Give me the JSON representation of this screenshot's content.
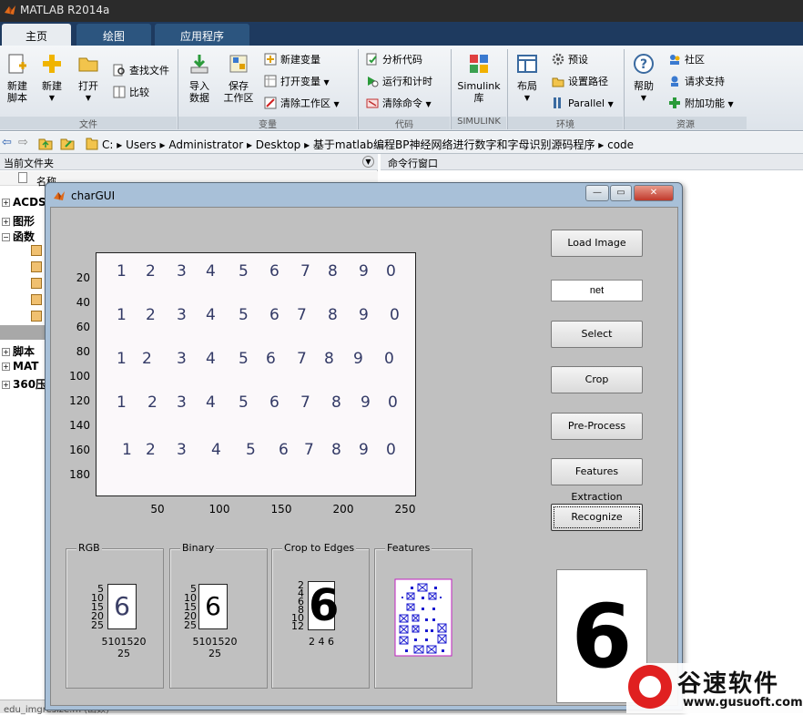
{
  "app": {
    "title": "MATLAB R2014a",
    "colors": {
      "tab_bar": "#1e3a5f",
      "tab_active": "#e8ecf0",
      "gui_bg": "#c0c0c0",
      "accent_red": "#e02020"
    }
  },
  "tabs": [
    {
      "label": "主页",
      "active": true
    },
    {
      "label": "绘图",
      "active": false
    },
    {
      "label": "应用程序",
      "active": false
    }
  ],
  "ribbon": {
    "file": {
      "new_script": "新建\n脚本",
      "new": "新建",
      "open": "打开",
      "find_files": "查找文件",
      "compare": "比较",
      "group": "文件"
    },
    "variable": {
      "import": "导入\n数据",
      "save_ws": "保存\n工作区",
      "new_var": "新建变量",
      "open_var": "打开变量",
      "clear_ws": "清除工作区",
      "group": "变量"
    },
    "code": {
      "analyze": "分析代码",
      "run_time": "运行和计时",
      "clear_cmd": "清除命令",
      "group": "代码"
    },
    "simulink": {
      "label": "Simulink\n库",
      "group": "SIMULINK"
    },
    "env": {
      "layout": "布局",
      "preferences": "预设",
      "set_path": "设置路径",
      "parallel": "Parallel",
      "group": "环境"
    },
    "resources": {
      "help": "帮助",
      "community": "社区",
      "request_support": "请求支持",
      "addons": "附加功能",
      "group": "资源"
    }
  },
  "address": {
    "crumbs": "C: ▸ Users ▸ Administrator ▸ Desktop ▸ 基于matlab编程BP神经网络进行数字和字母识别源码程序 ▸ code"
  },
  "left_panel": {
    "title": "当前文件夹",
    "name_col": "名称",
    "items": [
      "ACDS",
      "图形",
      "函数",
      "脚本",
      "MAT",
      "360压"
    ]
  },
  "right_panel": {
    "title": "命令行窗口"
  },
  "status": {
    "text": "edu_imgresize.m (函数)"
  },
  "gui": {
    "title": "charGUI",
    "win_buttons": {
      "min": "—",
      "max": "▭",
      "close": "✕"
    },
    "buttons": {
      "load_image": "Load Image",
      "select": "Select",
      "crop": "Crop",
      "preprocess": "Pre-Process",
      "features": "Features Extraction",
      "recognize": "Recognize"
    },
    "net_field": "net",
    "result": "6",
    "main_axes": {
      "yticks": [
        "20",
        "40",
        "60",
        "80",
        "100",
        "120",
        "140",
        "160",
        "180"
      ],
      "xticks": [
        "50",
        "100",
        "150",
        "200",
        "250"
      ],
      "rows": [
        [
          "1",
          "2",
          "3",
          "4",
          "5",
          "6",
          "7",
          "8",
          "9",
          "0"
        ],
        [
          "1",
          "2",
          "3",
          "4",
          "5",
          "6",
          "7",
          "8",
          "9",
          "0"
        ],
        [
          "1",
          "2",
          "3",
          "4",
          "5",
          "6",
          "7",
          "8",
          "9",
          "0"
        ],
        [
          "1",
          "2",
          "3",
          "4",
          "5",
          "6",
          "7",
          "8",
          "9",
          "0"
        ],
        [
          "1",
          "2",
          "3",
          "4",
          "5",
          "6",
          "7",
          "8",
          "9",
          "0"
        ]
      ]
    },
    "panels": {
      "rgb": {
        "label": "RGB",
        "yticks": [
          "5",
          "10",
          "15",
          "20",
          "25"
        ],
        "xticks": "5101520 25",
        "digit": "6"
      },
      "binary": {
        "label": "Binary",
        "yticks": [
          "5",
          "10",
          "15",
          "20",
          "25"
        ],
        "xticks": "5101520 25",
        "digit": "6"
      },
      "crop": {
        "label": "Crop to Edges",
        "yticks": [
          "2",
          "4",
          "6",
          "8",
          "10",
          "12"
        ],
        "xticks": "2 4 6",
        "digit": "6"
      },
      "features": {
        "label": "Features"
      }
    }
  },
  "watermark": {
    "brand": "谷速软件",
    "url": "www.gusuoft.com"
  }
}
